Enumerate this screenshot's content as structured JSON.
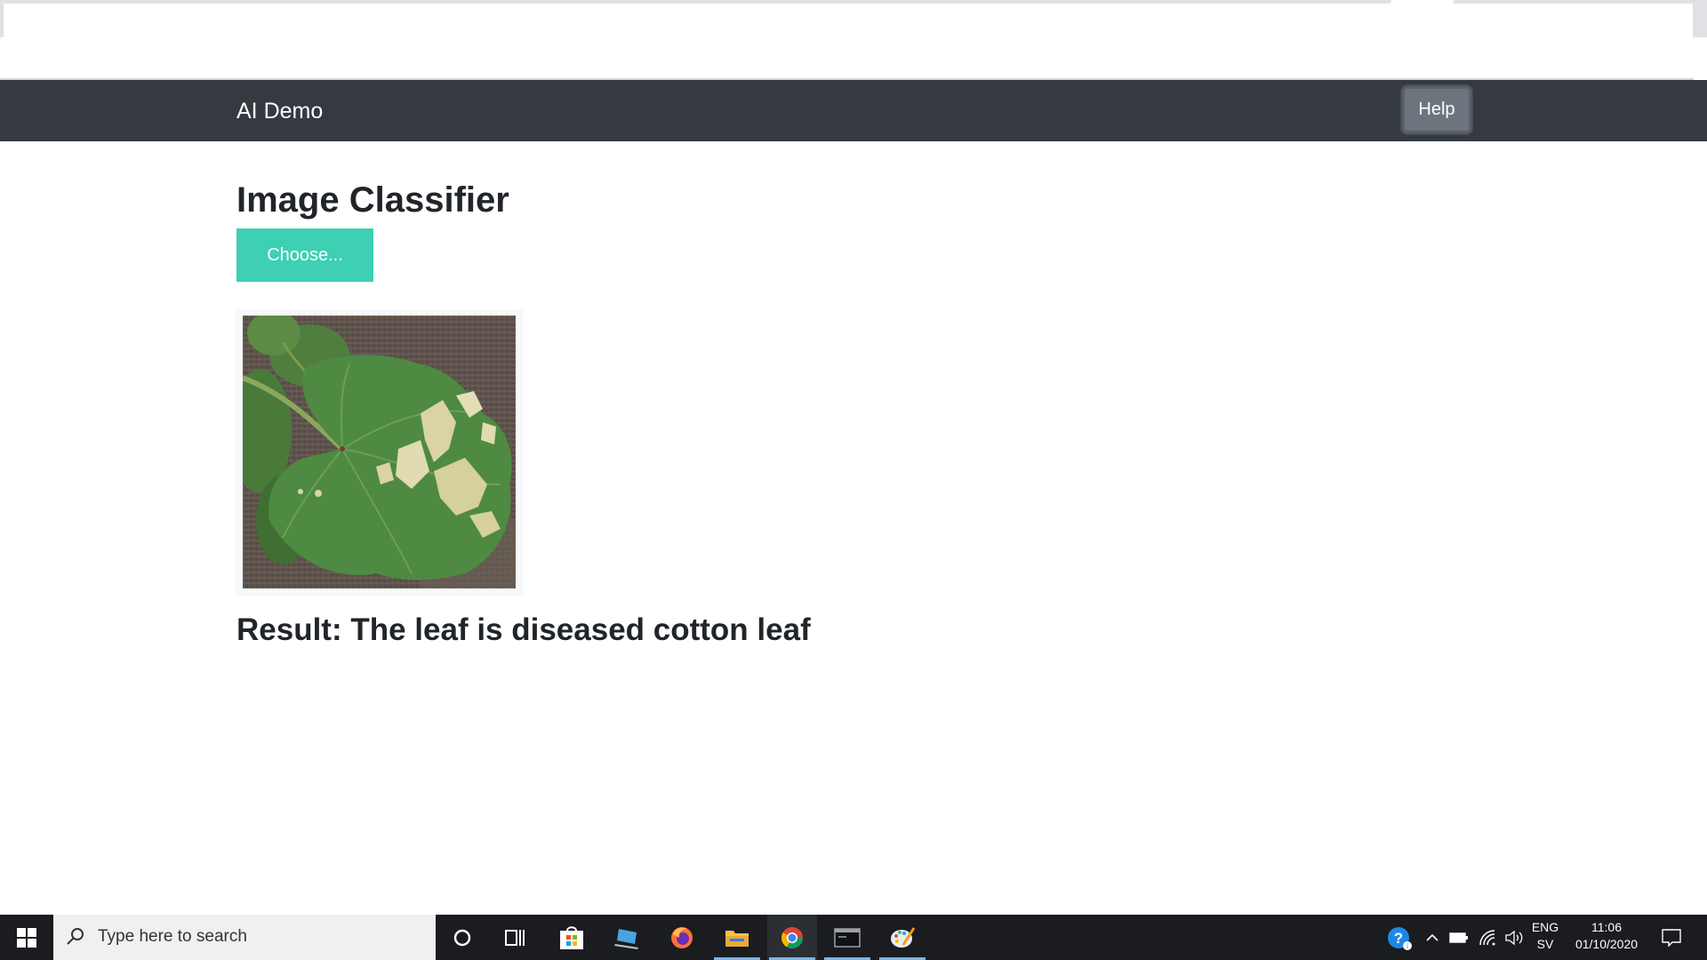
{
  "navbar": {
    "brand": "AI Demo",
    "help_label": "Help"
  },
  "main": {
    "title": "Image Classifier",
    "choose_label": "Choose...",
    "result_text": "Result: The leaf is diseased cotton leaf"
  },
  "taskbar": {
    "search_placeholder": "Type here to search",
    "apps": [
      "cortana-icon",
      "task-view-icon",
      "store-icon",
      "laptop-app-icon",
      "firefox-icon",
      "file-explorer-icon",
      "chrome-icon",
      "terminal-icon",
      "paint-icon"
    ],
    "tray": {
      "lang_top": "ENG",
      "lang_bottom": "SV",
      "time": "11:06",
      "date": "01/10/2020"
    }
  },
  "colors": {
    "navbar_bg": "#343a40",
    "choose_button": "#3ecfb4",
    "help_button": "#6c757d",
    "taskbar_bg": "#1a1c20"
  }
}
